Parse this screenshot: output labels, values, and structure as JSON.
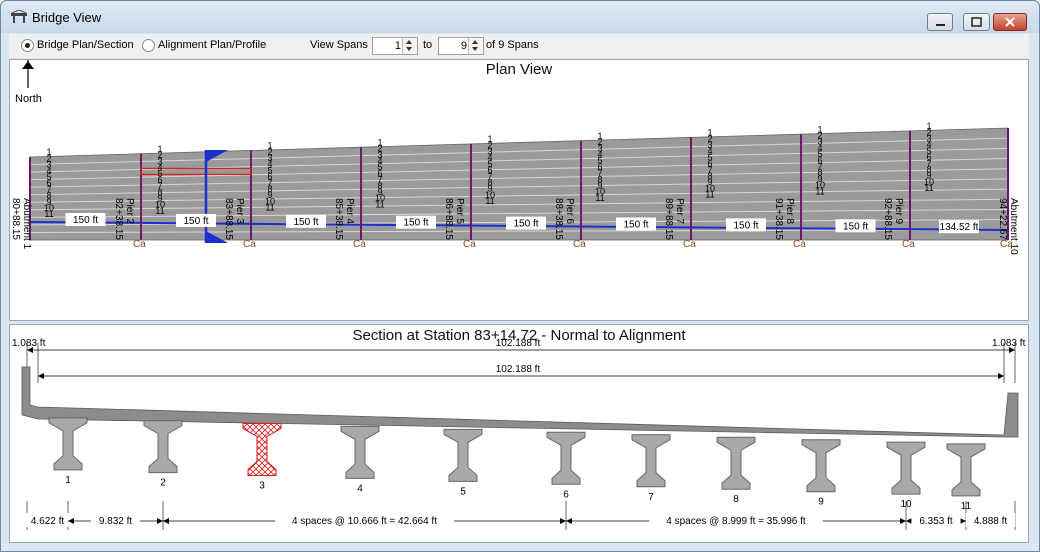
{
  "window": {
    "title": "Bridge View"
  },
  "toolbar": {
    "radio_bridge": "Bridge Plan/Section",
    "radio_alignment": "Alignment Plan/Profile",
    "view_spans_label": "View Spans",
    "from_value": "1",
    "to_label": "to",
    "to_value": "9",
    "of_label": "of 9 Spans"
  },
  "plan": {
    "title": "Plan View",
    "north_label": "North",
    "supports": [
      {
        "name": "Abutment 1",
        "station": "80+88.15"
      },
      {
        "name": "Pier 2",
        "station": "82+38.15"
      },
      {
        "name": "Pier 3",
        "station": "83+88.15"
      },
      {
        "name": "Pier 4",
        "station": "85+38.15"
      },
      {
        "name": "Pier 5",
        "station": "86+88.15"
      },
      {
        "name": "Pier 6",
        "station": "88+38.15"
      },
      {
        "name": "Pier 7",
        "station": "89+88.15"
      },
      {
        "name": "Pier 8",
        "station": "91+38.15"
      },
      {
        "name": "Pier 9",
        "station": "92+88.15"
      },
      {
        "name": "Abutment 10",
        "station": "94+22.67"
      }
    ],
    "span_lengths": [
      "150 ft",
      "150 ft",
      "150 ft",
      "150 ft",
      "150 ft",
      "150 ft",
      "150 ft",
      "150 ft",
      "134.52 ft"
    ],
    "ca_label": "Ca",
    "colors": {
      "deck": "#8f8f8f",
      "alignment": "#1a2fd0",
      "cut": "#1a2fd0",
      "pier": "#6b1a6b",
      "selected": "#e01a1a"
    }
  },
  "section": {
    "title": "Section at Station 83+14.72 - Normal to Alignment",
    "overhang_left": "1.083 ft",
    "overhang_right": "1.083 ft",
    "overall_width_top": "102.188 ft",
    "overall_width": "102.188 ft",
    "girders": [
      "1",
      "2",
      "3",
      "4",
      "5",
      "6",
      "7",
      "8",
      "9",
      "10",
      "11"
    ],
    "selected_girder": "3",
    "bottom_dims": [
      "4.622 ft",
      "9.832 ft",
      "4 spaces @ 10.666 ft = 42.664 ft",
      "4 spaces @ 8.999 ft = 35.996 ft",
      "6.353 ft",
      "4.888 ft"
    ]
  }
}
